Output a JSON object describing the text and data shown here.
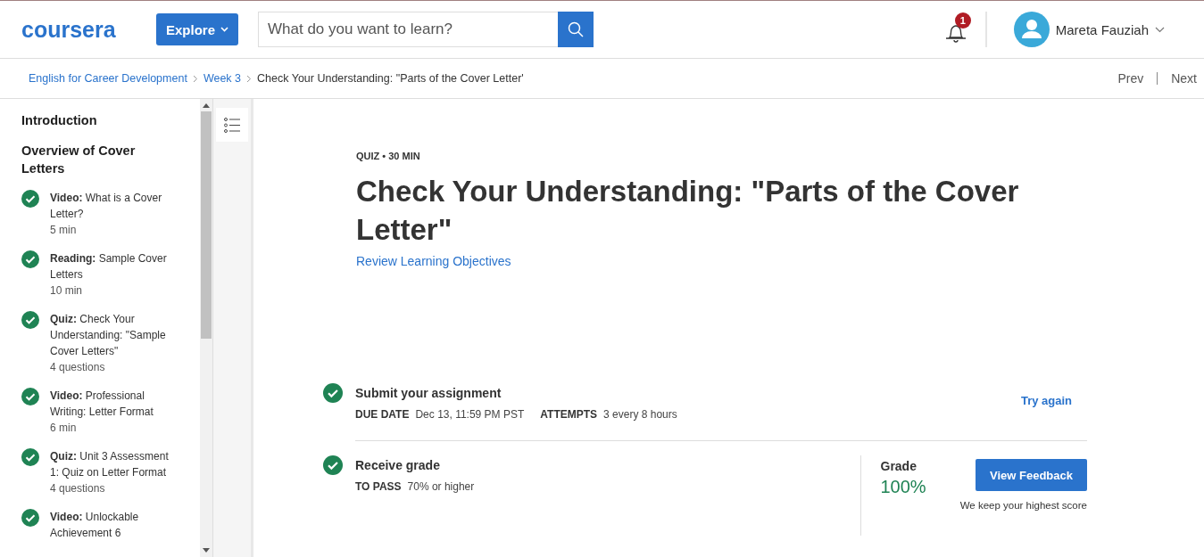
{
  "header": {
    "logo": "coursera",
    "explore_button": "Explore",
    "search": {
      "placeholder": "What do you want to learn?"
    },
    "notifications": {
      "count": "1"
    },
    "user": {
      "name": "Mareta Fauziah"
    }
  },
  "breadcrumb": {
    "items": [
      {
        "label": "English for Career Development",
        "kind": "link"
      },
      {
        "label": "Week 3",
        "kind": "link"
      },
      {
        "label": "Check Your Understanding: \"Parts of the Cover Letter'",
        "kind": "current"
      }
    ],
    "prev": "Prev",
    "next": "Next"
  },
  "sidebar": {
    "sections": [
      {
        "title": "Introduction"
      },
      {
        "title": "Overview of Cover Letters",
        "items": [
          {
            "label": "**Video:** What is a Cover Letter?",
            "meta": "5 min",
            "completed": true
          },
          {
            "label": "**Reading:** Sample Cover Letters",
            "meta": "10 min",
            "completed": true
          },
          {
            "label": "**Quiz:** Check Your Understanding: \"Sample Cover Letters\"",
            "meta": "4 questions",
            "completed": true
          },
          {
            "label": "**Video:** Professional Writing: Letter Format",
            "meta": "6 min",
            "completed": true
          },
          {
            "label": "**Quiz:** Unit 3 Assessment 1: Quiz on Letter Format",
            "meta": "4 questions",
            "completed": true
          },
          {
            "label": "**Video:** Unlockable Achievement 6",
            "completed": true
          }
        ]
      }
    ]
  },
  "quiz": {
    "label": "QUIZ • 30 MIN",
    "title": "Check Your Understanding: \"Parts of the Cover Letter\"",
    "objectives_link": "Review Learning Objectives",
    "submit": {
      "title": "Submit your assignment",
      "completed": true,
      "fields": [
        {
          "label": "DUE DATE",
          "value": "Dec 13, 11:59 PM PST"
        },
        {
          "label": "ATTEMPTS",
          "value": "3 every 8 hours"
        }
      ],
      "action": "Try again"
    },
    "grade": {
      "title": "Receive grade",
      "completed": true,
      "fields": [
        {
          "label": "TO PASS",
          "value": "70% or higher"
        }
      ],
      "grade_label": "Grade",
      "grade_value": "100%",
      "button": "View Feedback",
      "note": "We keep your highest score"
    }
  }
}
